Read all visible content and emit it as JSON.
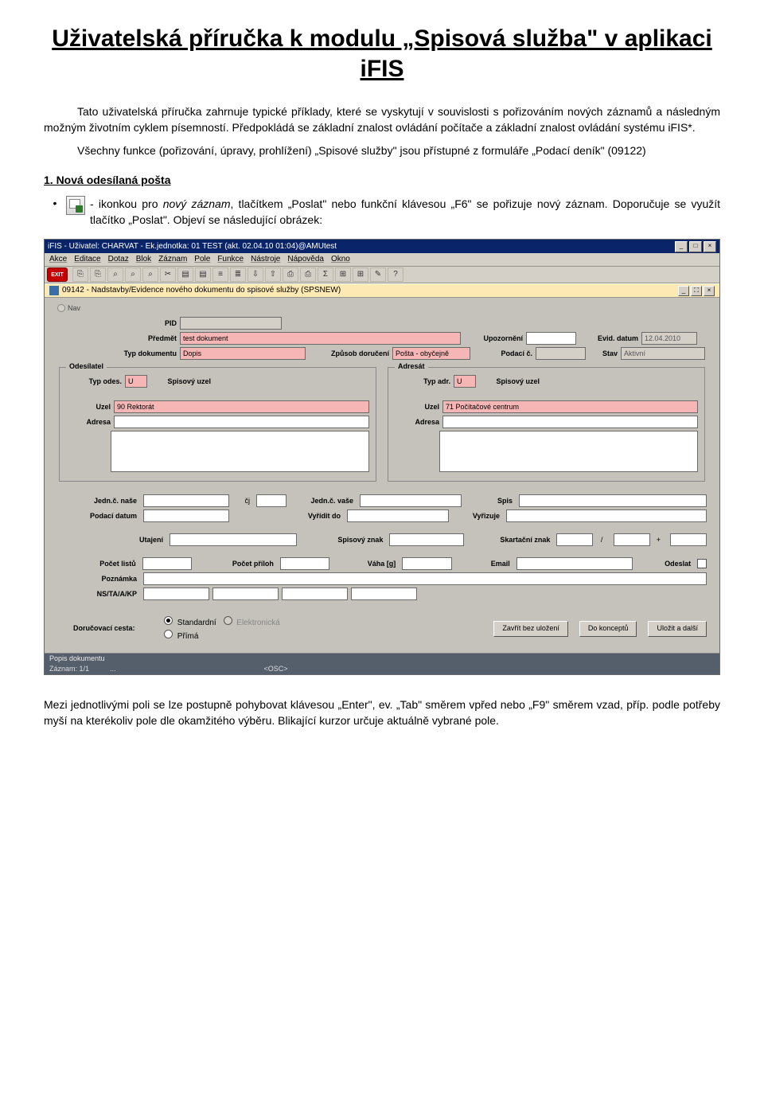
{
  "doc": {
    "title": "Uživatelská příručka k modulu „Spisová služba\" v aplikaci iFIS",
    "p1": "Tato uživatelská příručka zahrnuje typické příklady, které se vyskytují v souvislosti s pořizováním nových záznamů a následným možným životním cyklem písemností. Předpokládá se základní znalost ovládání počítače a základní znalost ovládání systému iFIS*.",
    "p2": "Všechny funkce (pořizování, úpravy, prohlížení) „Spisové služby\" jsou přístupné z formuláře „Podací deník\" (09122)",
    "section1": "1. Nová odesílaná pošta",
    "bullet_pre": " - ikonkou pro ",
    "bullet_ital": "nový záznam",
    "bullet_post": ", tlačítkem „Poslat\" nebo funkční klávesou „F6\" se pořizuje nový záznam. Doporučuje se využít tlačítko „Poslat\". Objeví se následující obrázek:",
    "p3": "Mezi jednotlivými poli se lze postupně pohybovat klávesou „Enter\", ev. „Tab\" směrem vpřed nebo „F9\" směrem vzad, příp. podle potřeby myší na kterékoliv pole dle okamžitého výběru. Blikající kurzor určuje aktuálně vybrané pole."
  },
  "app": {
    "wintitle": "iFIS - Uživatel: CHARVAT - Ek.jednotka: 01 TEST (akt. 02.04.10 01:04)@AMUtest",
    "menu": [
      "Akce",
      "Editace",
      "Dotaz",
      "Blok",
      "Záznam",
      "Pole",
      "Funkce",
      "Nástroje",
      "Nápověda",
      "Okno"
    ],
    "subtitle": "09142 - Nadstavby/Evidence nového dokumentu do spisové služby (SPSNEW)",
    "nav": "Nav",
    "labels": {
      "pid": "PID",
      "predmet": "Předmět",
      "typdok": "Typ dokumentu",
      "upozorneni": "Upozornění",
      "eviddatum": "Evid. datum",
      "zpusob": "Způsob doručení",
      "podacic": "Podací č.",
      "stav": "Stav",
      "odesilatel": "Odesílatel",
      "adresat": "Adresát",
      "typodes": "Typ odes.",
      "typadr": "Typ adr.",
      "spisuzel": "Spisový uzel",
      "uzel": "Uzel",
      "adresa": "Adresa",
      "jednnase": "Jedn.č. naše",
      "cj": "čj",
      "jednvase": "Jedn.č. vaše",
      "spis": "Spis",
      "podacidatum": "Podací datum",
      "vyriditdo": "Vyřídit do",
      "vyrizuje": "Vyřizuje",
      "utajeni": "Utajení",
      "spisznak": "Spisový znak",
      "skartznak": "Skartační znak",
      "slash": "/",
      "plus": "+",
      "pocetlistu": "Počet listů",
      "pocetpriloh": "Počet příloh",
      "vaha": "Váha [g]",
      "email": "Email",
      "odeslat": "Odeslat",
      "poznamka": "Poznámka",
      "nstakp": "NS/TA/A/KP",
      "doruc": "Doručovací cesta:",
      "r_standard": "Standardní",
      "r_elektron": "Elektronická",
      "r_prima": "Přímá",
      "btn_zavrit": "Zavřít bez uložení",
      "btn_koncept": "Do konceptů",
      "btn_ulozit": "Uložit a další",
      "status1": "Popis dokumentu",
      "status2a": "Záznam: 1/1",
      "status2b": "...",
      "status2c": "<OSC>"
    },
    "values": {
      "predmet": "test dokument",
      "typdok": "Dopis",
      "eviddatum": "12.04.2010",
      "zpusob": "Pošta - obyčejně",
      "stav": "Aktivní",
      "typodes": "U",
      "typadr": "U",
      "uzel_o": "90 Rektorát",
      "uzel_a": "71 Počítačové centrum"
    }
  }
}
